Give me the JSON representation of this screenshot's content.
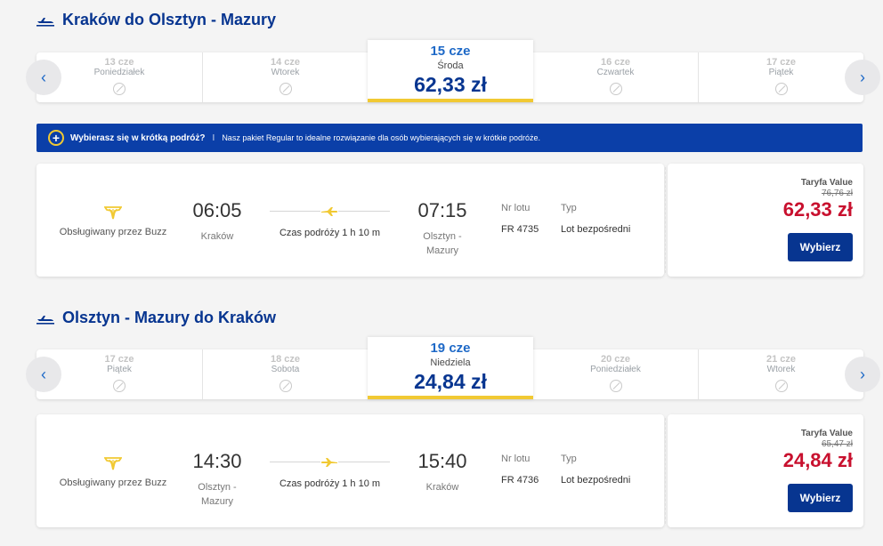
{
  "outbound": {
    "title": "Kraków do Olsztyn - Mazury",
    "dates": [
      {
        "day": "13 cze",
        "weekday": "Poniedziałek"
      },
      {
        "day": "14 cze",
        "weekday": "Wtorek"
      },
      {
        "day": "15 cze",
        "weekday": "Środa",
        "price": "62,33 zł"
      },
      {
        "day": "16 cze",
        "weekday": "Czwartek"
      },
      {
        "day": "17 cze",
        "weekday": "Piątek"
      }
    ],
    "flight": {
      "operator": "Obsługiwany przez Buzz",
      "depart_time": "06:05",
      "depart_place": "Kraków",
      "duration": "Czas podróży 1 h 10 m",
      "arrive_time": "07:15",
      "arrive_place_1": "Olsztyn -",
      "arrive_place_2": "Mazury",
      "flight_no_label": "Nr lotu",
      "flight_no": "FR 4735",
      "type_label": "Typ",
      "type": "Lot bezpośredni",
      "fare_name": "Taryfa Value",
      "old_price": "76,76 zł",
      "price": "62,33 zł",
      "select_label": "Wybierz"
    }
  },
  "promo": {
    "question": "Wybierasz się w krótką podróż?",
    "separator": "I",
    "message": "Nasz pakiet Regular to idealne rozwiązanie dla osób wybierających się w krótkie podróże."
  },
  "inbound": {
    "title": "Olsztyn - Mazury do Kraków",
    "dates": [
      {
        "day": "17 cze",
        "weekday": "Piątek"
      },
      {
        "day": "18 cze",
        "weekday": "Sobota"
      },
      {
        "day": "19 cze",
        "weekday": "Niedziela",
        "price": "24,84 zł"
      },
      {
        "day": "20 cze",
        "weekday": "Poniedziałek"
      },
      {
        "day": "21 cze",
        "weekday": "Wtorek"
      }
    ],
    "flight": {
      "operator": "Obsługiwany przez Buzz",
      "depart_time": "14:30",
      "depart_place_1": "Olsztyn -",
      "depart_place_2": "Mazury",
      "duration": "Czas podróży 1 h 10 m",
      "arrive_time": "15:40",
      "arrive_place": "Kraków",
      "flight_no_label": "Nr lotu",
      "flight_no": "FR 4736",
      "type_label": "Typ",
      "type": "Lot bezpośredni",
      "fare_name": "Taryfa Value",
      "old_price": "65,47 zł",
      "price": "24,84 zł",
      "select_label": "Wybierz"
    }
  },
  "colors": {
    "brand_blue": "#073590",
    "accent_yellow": "#f1c933",
    "price_red": "#c8102e",
    "promo_blue": "#0b3fa8"
  },
  "icons": {
    "section": "plane-takeoff-icon",
    "unavailable": "no-flights-icon",
    "airline": "harp-logo-icon",
    "prev": "chevron-left-icon",
    "next": "chevron-right-icon"
  }
}
